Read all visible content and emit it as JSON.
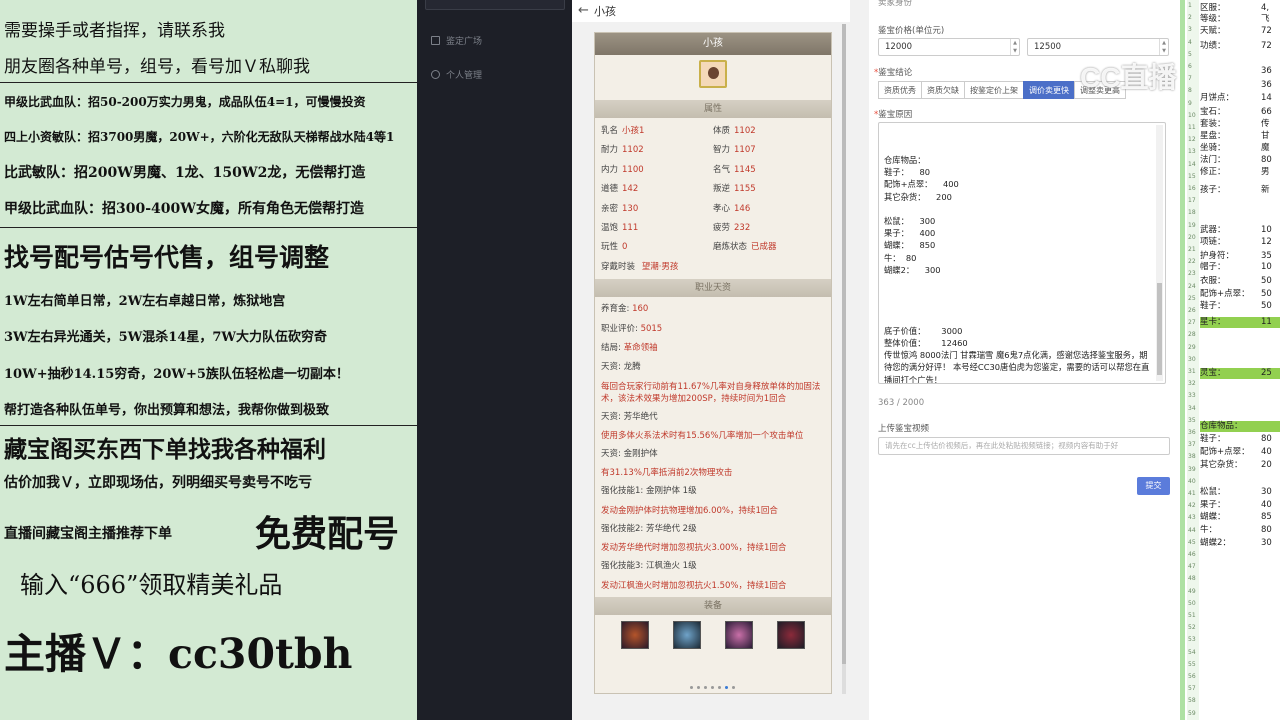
{
  "ad": {
    "lines": [
      "需要操手或者指挥，请联系我",
      "朋友圈各种单号，组号，看号加Ｖ私聊我",
      "甲级比武血队：招50-200万实力男鬼，成品队伍4=1，可慢慢投资",
      "四上小资敏队：招3700男魔，20W+，六阶化无敌队天梯帮战水陆4等1",
      "比武敏队：招200W男魔、1龙、150W2龙，无偿帮打造",
      "甲级比武血队：招300-400W女魔，所有角色无偿帮打造",
      "找号配号估号代售，组号调整",
      "1W左右简单日常，2W左右卓越日常，炼狱地宫",
      "3W左右异光通关，5W混杀14星，7W大力队伍砍穷奇",
      "10W+抽秒14.15穷奇，20W+5族队伍轻松虐一切副本！",
      "帮打造各种队伍单号，你出预算和想法，我帮你做到极致",
      "藏宝阁买东西下单找我各种福利",
      "估价加我Ｖ，立即现场估，列明细买号卖号不吃亏",
      "直播间藏宝阁主播推荐下单",
      "免费配号",
      "输入“666”领取精美礼品",
      "主播Ｖ：cc30tbh"
    ]
  },
  "sidebar": {
    "items": [
      "鉴定广场",
      "个人管理"
    ]
  },
  "breadcrumb": {
    "back_icon": "←",
    "title": "小孩"
  },
  "card": {
    "header": "小孩",
    "section_attrs": "属性",
    "attrs": [
      {
        "k": "乳名",
        "v": "小孩1"
      },
      {
        "k": "体质",
        "v": "1102"
      },
      {
        "k": "耐力",
        "v": "1102"
      },
      {
        "k": "智力",
        "v": "1107"
      },
      {
        "k": "内力",
        "v": "1100"
      },
      {
        "k": "名气",
        "v": "1145"
      },
      {
        "k": "道德",
        "v": "142"
      },
      {
        "k": "叛逆",
        "v": "1155"
      },
      {
        "k": "亲密",
        "v": "130"
      },
      {
        "k": "孝心",
        "v": "146"
      },
      {
        "k": "温饱",
        "v": "111"
      },
      {
        "k": "疲劳",
        "v": "232"
      },
      {
        "k": "玩性",
        "v": "0"
      },
      {
        "k": "磨炼状态",
        "v": "已成器"
      }
    ],
    "outfit_label": "穿戴时装",
    "outfit_value": "望潮·男孩",
    "section_talent": "职业天资",
    "talent_lines": [
      {
        "text": "养育金: ",
        "val": "160"
      },
      {
        "text": "职业评价: ",
        "val": "5015"
      },
      {
        "text": "结局: ",
        "val": "革命领袖"
      },
      {
        "text": "天资: 龙腾",
        "val": ""
      }
    ],
    "talent_details": [
      {
        "red": "每回合玩家行动前有11.67%几率对自身释放单体的加固法术，该法术效果为增加200SP，持续时间为1回合"
      },
      {
        "gray": "天资: 芳华绝代"
      },
      {
        "red": "使用多体火系法术时有15.56%几率增加一个攻击单位"
      },
      {
        "gray": "天资: 金刚护体"
      },
      {
        "red": "有31.13%几率抵消前2次物理攻击"
      },
      {
        "gray": "强化技能1: 金刚护体 1级"
      },
      {
        "red": "发动金刚护体时抗物理增加6.00%，持续1回合"
      },
      {
        "gray": "强化技能2: 芳华绝代 2级"
      },
      {
        "red": "发动芳华绝代时增加忽视抗火3.00%，持续1回合"
      },
      {
        "gray": "强化技能3: 江枫渔火 1级"
      },
      {
        "red": "发动江枫渔火时增加忽视抗火1.50%，持续1回合"
      }
    ],
    "section_equip": "装备"
  },
  "form": {
    "section_title": "卖家身份",
    "price_label": "鉴宝价格(单位元)",
    "price_low": "12000",
    "price_high": "12500",
    "conclusion_label": "鉴宝结论",
    "tabs": [
      "资质优秀",
      "资质欠缺",
      "按鉴定价上架",
      "调价卖更快",
      "调整卖更高"
    ],
    "active_tab": 3,
    "reason_label": "鉴宝原因",
    "reason_lines": [
      "仓库物品：",
      "鞋子：    80",
      "配饰+点翠：    400",
      "其它杂货：    200",
      "",
      "松鼠：    300",
      "果子：    400",
      "蝴蝶：    850",
      "牛：  80",
      "蝴蝶2：    300",
      "",
      "",
      "",
      "",
      "底子价值：      3000",
      "整体价值：      12460",
      "传世惊鸿 8000法门 甘霖瑞雪 魔6鬼7点化满，感谢您选择鉴宝服务，期待您的满分好评！ 本号经CC30唐伯虎为您鉴定，需要的话可以帮您在直播间打个广告！"
    ],
    "counter": "363 / 2000",
    "video_label": "上传鉴宝视频",
    "video_placeholder": "请先在cc上传估价视频后，再在此处粘贴视频链接；视频内容有助于好",
    "submit": "提交"
  },
  "right_panel": {
    "rows": [
      {
        "k": "区服：",
        "v": "4,"
      },
      {
        "k": "等级：",
        "v": "飞"
      },
      {
        "k": "天赋：",
        "v": "72"
      },
      {
        "k": "功绩：",
        "v": "72"
      },
      {
        "k": "",
        "v": "36"
      },
      {
        "k": "",
        "v": "36"
      },
      {
        "k": "月饼点：",
        "v": "14"
      },
      {
        "k": "宝石：",
        "v": "66"
      },
      {
        "k": "套装：",
        "v": "传"
      },
      {
        "k": "星盘：",
        "v": "甘"
      },
      {
        "k": "坐骑：",
        "v": "魔"
      },
      {
        "k": "法门：",
        "v": "80"
      },
      {
        "k": "修正：",
        "v": "男"
      },
      {
        "k": "孩子：",
        "v": "新"
      },
      {
        "k": "武器：",
        "v": "10"
      },
      {
        "k": "项链：",
        "v": "12"
      },
      {
        "k": "护身符：",
        "v": "35"
      },
      {
        "k": "帽子：",
        "v": "10"
      },
      {
        "k": "衣服：",
        "v": "50"
      },
      {
        "k": "配饰+点翠：",
        "v": "50"
      },
      {
        "k": "鞋子：",
        "v": "50"
      },
      {
        "k": "星卡：",
        "v": "11"
      },
      {
        "k": "灵宝：",
        "v": "25"
      },
      {
        "k": "仓库物品：",
        "v": ""
      },
      {
        "k": "鞋子：",
        "v": "80"
      },
      {
        "k": "配饰+点翠：",
        "v": "40"
      },
      {
        "k": "其它杂货：",
        "v": "20"
      },
      {
        "k": "松鼠：",
        "v": "30"
      },
      {
        "k": "果子：",
        "v": "40"
      },
      {
        "k": "蝴蝶：",
        "v": "85"
      },
      {
        "k": "牛：",
        "v": "80"
      },
      {
        "k": "蝴蝶2：",
        "v": "30"
      }
    ],
    "highlight_rows": [
      21,
      22,
      23
    ]
  },
  "watermark": "CC直播"
}
